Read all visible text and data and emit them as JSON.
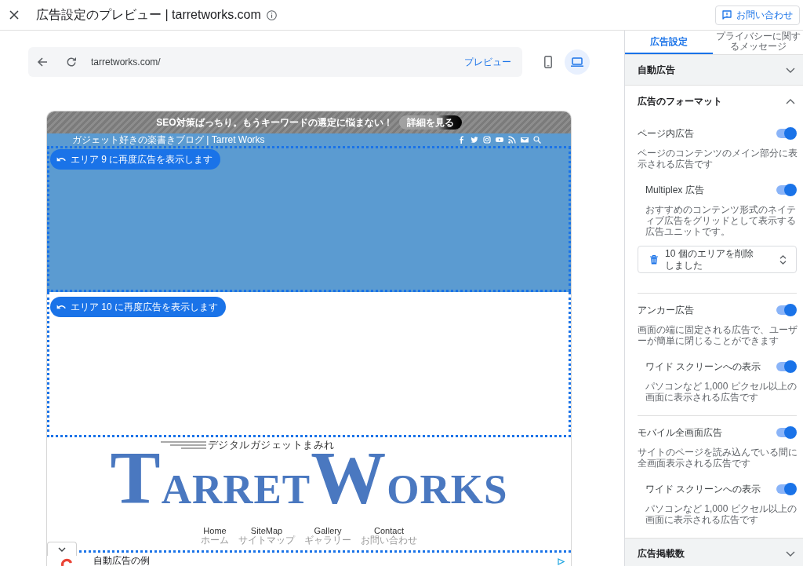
{
  "top_bar": {
    "title": "広告設定のプレビュー | tarretworks.com",
    "contact_button": "お問い合わせ"
  },
  "preview_toolbar": {
    "url": "tarretworks.com/",
    "preview_link": "プレビュー",
    "devices": [
      {
        "kind": "phone",
        "selected": false
      },
      {
        "kind": "laptop",
        "selected": true
      }
    ]
  },
  "site": {
    "banner": {
      "text": "SEO対策ばっちり。もうキーワードの選定に悩まない！",
      "button": "詳細を見る"
    },
    "tagline": "ガジェット好きの楽書きブログ | Tarret Works",
    "ad_areas": [
      {
        "button": "エリア 9 に再度広告を表示します"
      },
      {
        "button": "エリア 10 に再度広告を表示します"
      }
    ],
    "logo": {
      "subtitle": "デジタルガジェットまみれ",
      "wordmark": [
        "TARRET",
        "WORKS"
      ]
    },
    "nav": [
      {
        "label": "Home",
        "sub": "ホーム"
      },
      {
        "label": "SiteMap",
        "sub": "サイトマップ"
      },
      {
        "label": "Gallery",
        "sub": "ギャラリー"
      },
      {
        "label": "Contact",
        "sub": "お問い合わせ"
      }
    ],
    "anchor_ad": {
      "text": "自動広告の例"
    }
  },
  "settings_panel": {
    "tabs": [
      {
        "label": "広告設定",
        "selected": true
      },
      {
        "label": "プライバシーに関するメッセージ",
        "selected": false
      }
    ],
    "sections": [
      {
        "title": "自動広告",
        "expanded": false
      },
      {
        "title": "広告のフォーマット",
        "expanded": true,
        "formats": [
          {
            "title": "ページ内広告",
            "on": true,
            "description": "ページのコンテンツのメイン部分に表示される広告です",
            "sub_options": [
              {
                "title": "Multiplex 広告",
                "on": true,
                "description": "おすすめのコンテンツ形式のネイティブ広告をグリッドとして表示する広告ユニットです。"
              }
            ],
            "select": "10 個のエリアを削除しました"
          },
          {
            "title": "アンカー広告",
            "on": true,
            "description": "画面の端に固定される広告で、ユーザーが簡単に閉じることができます",
            "sub_options": [
              {
                "title": "ワイド スクリーンへの表示",
                "on": true,
                "description": "パソコンなど 1,000 ピクセル以上の画面に表示される広告です"
              }
            ]
          },
          {
            "title": "モバイル全画面広告",
            "on": true,
            "description": "サイトのページを読み込んでいる間に全画面表示される広告です",
            "sub_options": [
              {
                "title": "ワイド スクリーンへの表示",
                "on": true,
                "description": "パソコンなど 1,000 ピクセル以上の画面に表示される広告です"
              }
            ]
          }
        ]
      },
      {
        "title": "広告掲載数",
        "expanded": false
      }
    ]
  }
}
